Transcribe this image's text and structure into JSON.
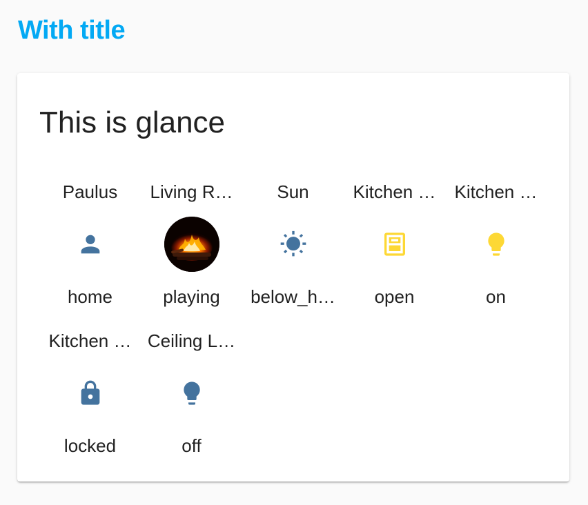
{
  "page": {
    "heading": "With title"
  },
  "card": {
    "title": "This is glance"
  },
  "colors": {
    "heading": "#03a9f4",
    "icon_default": "#44739e",
    "icon_active": "#fdd835"
  },
  "entities": [
    {
      "name": "Paulus",
      "state": "home",
      "icon": "account-icon",
      "active": false
    },
    {
      "name": "Living R…",
      "state": "playing",
      "icon": "media-thumbnail",
      "active": false
    },
    {
      "name": "Sun",
      "state": "below_h…",
      "icon": "sun-icon",
      "active": false
    },
    {
      "name": "Kitchen …",
      "state": "open",
      "icon": "cabinet-door-icon",
      "active": true
    },
    {
      "name": "Kitchen …",
      "state": "on",
      "icon": "lightbulb-icon",
      "active": true
    },
    {
      "name": "Kitchen …",
      "state": "locked",
      "icon": "lock-icon",
      "active": false
    },
    {
      "name": "Ceiling L…",
      "state": "off",
      "icon": "lightbulb-icon",
      "active": false
    }
  ]
}
